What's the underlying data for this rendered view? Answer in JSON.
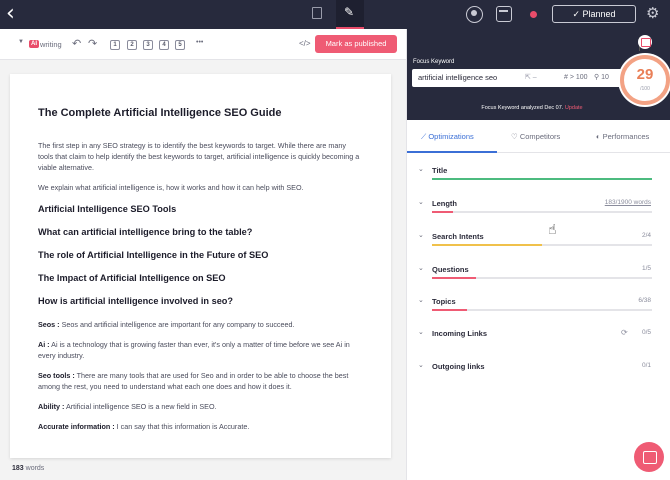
{
  "topbar": {
    "back_icon": "‹",
    "planned_label": "✓ Planned",
    "gear_icon": "⚙"
  },
  "toolbar": {
    "ai_badge": "AI",
    "mode_label": "writing",
    "undo": "↶",
    "redo": "↷",
    "headings": [
      "1",
      "2",
      "3",
      "4",
      "5"
    ],
    "more": "•••",
    "code": "</>",
    "publish_label": "Mark as published"
  },
  "document": {
    "title": "The Complete Artificial Intelligence SEO Guide",
    "intro": "The first step in any SEO strategy is to identify the best keywords to target. While there are many tools that claim to help identify the best keywords to target, artificial intelligence is quickly becoming a viable alternative.",
    "intro2": "We explain what artificial intelligence is, how it works and how it can help with SEO.",
    "headings": [
      "Artificial Intelligence SEO Tools",
      "What can artificial intelligence bring to the table?",
      "The role of Artificial Intelligence in the Future of SEO",
      "The Impact of Artificial Intelligence on SEO",
      "How is artificial intelligence involved in seo?"
    ],
    "definitions": [
      {
        "term": "Seos :",
        "text": " Seos and artificial intelligence are important for any company to succeed."
      },
      {
        "term": "Ai :",
        "text": " Ai is a technology that is growing faster than ever, it's only a matter of time before we see Ai in every industry."
      },
      {
        "term": "Seo tools :",
        "text": " There are many tools that are used for Seo and in order to be able to choose the best among the rest, you need to understand what each one does and how it does it."
      },
      {
        "term": "Ability :",
        "text": " Artificial intelligence SEO is a new field in SEO."
      },
      {
        "term": "Accurate information :",
        "text": " I can say that this information is Accurate."
      }
    ],
    "word_count": "183",
    "word_label": " words"
  },
  "keyword_panel": {
    "label": "Focus Keyword",
    "keyword": "artificial intelligence seo",
    "metric1": "⇱ –",
    "metric2": "# > 100",
    "metric3": "⚲ 10",
    "analyzed_text": "Focus Keyword analyzed Dec 07.",
    "update_link": "Update",
    "close_icon": "×",
    "score": "29",
    "score_max": "/100"
  },
  "tabs": [
    {
      "label": "Optimizations",
      "icon": "⟋"
    },
    {
      "label": "Competitors",
      "icon": "♡"
    },
    {
      "label": "Performances",
      "icon": "◐"
    }
  ],
  "optimizations": [
    {
      "label": "Title",
      "count": "",
      "fill": 1.0,
      "color": "#4cbb7f"
    },
    {
      "label": "Length",
      "count": "183/1900 words",
      "fill": 0.096,
      "color": "#ef5b74"
    },
    {
      "label": "Search Intents",
      "count": "2/4",
      "fill": 0.5,
      "color": "#f0c14b"
    },
    {
      "label": "Questions",
      "count": "1/5",
      "fill": 0.2,
      "color": "#ef5b74"
    },
    {
      "label": "Topics",
      "count": "6/38",
      "fill": 0.158,
      "color": "#ef5b74"
    },
    {
      "label": "Incoming Links",
      "count": "0/5",
      "fill": 0,
      "color": "#ef5b74",
      "sync": "⟳"
    },
    {
      "label": "Outgoing links",
      "count": "0/1",
      "fill": 0,
      "color": "#ef5b74"
    }
  ]
}
